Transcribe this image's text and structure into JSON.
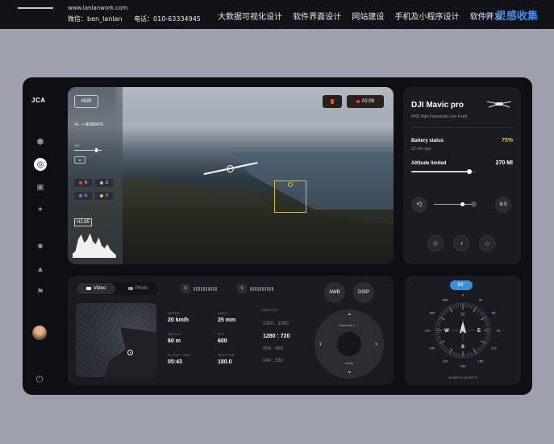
{
  "banner": {
    "site_url": "www.lanlanwork.com",
    "wechat": "微信：ben_lanlan",
    "phone": "电话：010-63334945",
    "nav": [
      "大数据可视化设计",
      "软件界面设计",
      "网站建设",
      "手机及小程序设计",
      "软件开发"
    ],
    "brand": "灵感收集",
    "brand_icon": "star-icon"
  },
  "sidebar": {
    "logo": "JCA",
    "items": [
      {
        "name": "home-icon",
        "glyph": "⬢",
        "active": false
      },
      {
        "name": "compass-nav-icon",
        "glyph": "◎",
        "active": true
      },
      {
        "name": "gallery-icon",
        "glyph": "▣",
        "active": false
      },
      {
        "name": "signal-icon",
        "glyph": "✦",
        "active": false
      },
      {
        "name": "settings-icon",
        "glyph": "✸",
        "active": false
      },
      {
        "name": "bell-icon",
        "glyph": "▲",
        "active": false
      },
      {
        "name": "flag-icon",
        "glyph": "⚑",
        "active": false
      }
    ],
    "power_glyph": "⏻"
  },
  "camera": {
    "hdr_label": "HDR",
    "resolution": "4K",
    "resolution_detail": "• 4K/60FPS",
    "ev_label": "ISO",
    "ev_box": "42",
    "chips": [
      "N",
      "D",
      "G",
      "V"
    ],
    "chip_colors": [
      "#e64a3b",
      "#bbbbbb",
      "#3b8fd9",
      "#f2c230"
    ],
    "histogram_label": "H2.85",
    "histogram": [
      0.15,
      0.25,
      0.7,
      0.85,
      0.55,
      0.65,
      0.9,
      0.6,
      0.5,
      0.75,
      0.45,
      0.35,
      0.5,
      0.3,
      0.2,
      0.1
    ],
    "rec_time": "02:09"
  },
  "drone": {
    "name": "DJI Mavic pro",
    "feed": "FHD high-Framerate Live Feed",
    "battery_label": "Battery status",
    "battery_time": "12 min ago",
    "battery_value": "75%",
    "altitude_label": "Altitude limited",
    "altitude_value": "270 MI",
    "altitude_fill": 0.9,
    "lens_label": "•Q",
    "zoom_position": 0.7,
    "zoom_value": "8.3",
    "mini_buttons": [
      "◎",
      "◑",
      "◇"
    ]
  },
  "control": {
    "tab_video": "Video",
    "tab_photo": "Photo",
    "param_a": "S",
    "param_b": "S",
    "awb": "AWB",
    "disp": "DISP",
    "stats": [
      {
        "label": "SPEED",
        "value": "20 km/h"
      },
      {
        "label": "LENS",
        "value": "25 mm"
      },
      {
        "label": "HEIGHT",
        "value": "60 m"
      },
      {
        "label": "ISO",
        "value": "600"
      },
      {
        "label": "FLIGHT TIME",
        "value": "05:43"
      },
      {
        "label": "SHUTTER",
        "value": "180.0"
      }
    ],
    "res_label": "VIDEO LTE",
    "res_options": [
      "1920 : 1080",
      "1280 : 720",
      "854 : 480",
      "640 : 360"
    ],
    "res_active": 1,
    "dpad_top_label": "Stop/return",
    "dpad_bottom_label": "mode"
  },
  "compass": {
    "badge": "83°",
    "cardinals": [
      "N",
      "E",
      "S",
      "W"
    ],
    "degree_labels": [
      "0",
      "30",
      "60",
      "90",
      "120",
      "150",
      "180",
      "210",
      "240",
      "270",
      "300",
      "330"
    ],
    "coords": "40°56'0\"N 40°56'0\"E"
  }
}
